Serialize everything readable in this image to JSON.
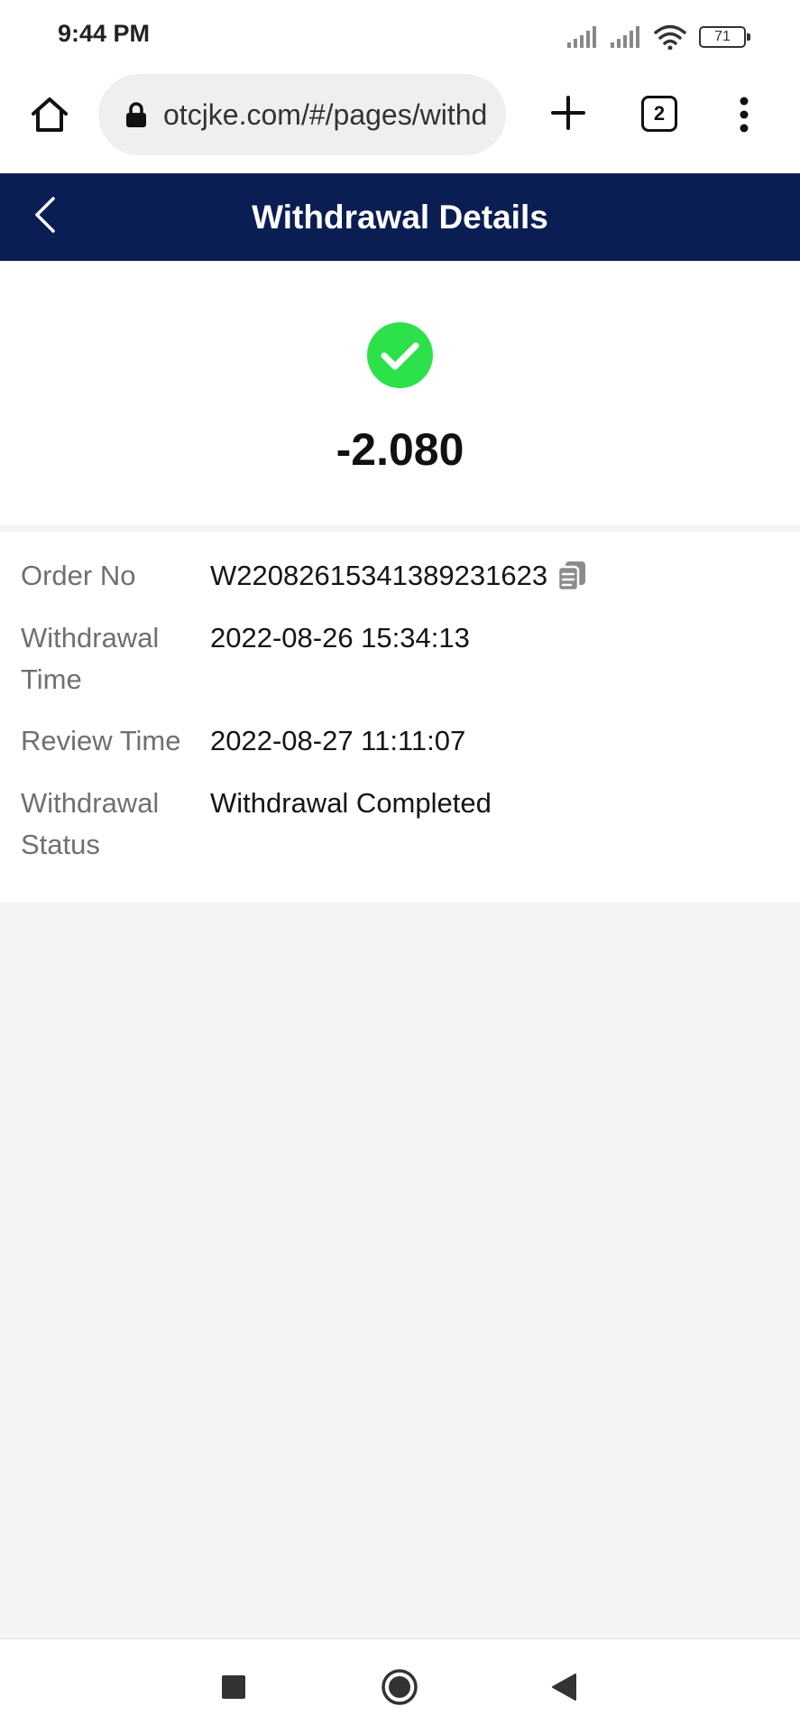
{
  "status_bar": {
    "time": "9:44 PM",
    "battery": "71"
  },
  "browser": {
    "url": "otcjke.com/#/pages/withdrawal",
    "tab_count": "2"
  },
  "header": {
    "title": "Withdrawal Details"
  },
  "summary": {
    "amount": "-2.080",
    "success_color": "#2de14a"
  },
  "details": {
    "rows": [
      {
        "label": "Order No",
        "value": "W22082615341389231623"
      },
      {
        "label": "Withdrawal Time",
        "value": "2022-08-26 15:34:13"
      },
      {
        "label": "Review Time",
        "value": "2022-08-27 11:11:07"
      },
      {
        "label": "Withdrawal Status",
        "value": "Withdrawal Completed"
      }
    ]
  },
  "colors": {
    "header_bg": "#0b1e53",
    "page_bg": "#f4f4f5"
  }
}
